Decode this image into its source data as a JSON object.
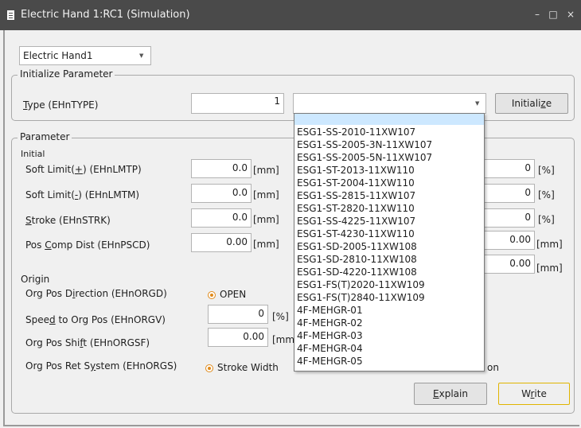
{
  "window": {
    "title": "Electric Hand 1:RC1  (Simulation)",
    "minimize_glyph": "–",
    "maximize_glyph": "□",
    "close_glyph": "×"
  },
  "colors": {
    "titlebar": "#4a4a4a",
    "accent_orange": "#e08a1a",
    "highlight": "#cde8ff"
  },
  "hand_selector": {
    "value": "Electric Hand1"
  },
  "init_group": {
    "legend": "Initialize Parameter",
    "type_label_u": "T",
    "type_label_rest": "ype (EHnTYPE)",
    "type_value": "1",
    "model_value": "",
    "initialize_pre": "Initiali",
    "initialize_u": "z",
    "initialize_post": "e"
  },
  "param_group": {
    "legend": "Parameter",
    "initial_heading": "Initial",
    "soft_limit_plus": {
      "pre": "Soft Limit(",
      "u": "+",
      "post": ") (EHnLMTP)",
      "value": "0.0",
      "unit": "[mm]"
    },
    "soft_limit_minus": {
      "pre": "Soft Limit(",
      "u": "-",
      "post": ") (EHnLMTM)",
      "value": "0.0",
      "unit": "[mm]"
    },
    "stroke": {
      "pre": "",
      "u": "S",
      "post": "troke (EHnSTRK)",
      "value": "0.0",
      "unit": "[mm]"
    },
    "pos_comp": {
      "pre": "Pos ",
      "u": "C",
      "post": "omp Dist (EHnPSCD)",
      "value": "0.00",
      "unit": "[mm]"
    },
    "right_values": [
      {
        "value": "0",
        "unit": "[%]"
      },
      {
        "value": "0",
        "unit": "[%]"
      },
      {
        "value": "0",
        "unit": "[%]"
      },
      {
        "value": "0.00",
        "unit": "[mm]"
      },
      {
        "value": "0.00",
        "unit": "[mm]"
      }
    ],
    "origin_heading": "Origin",
    "org_dir": {
      "pre": "Org Pos D",
      "u": "i",
      "post": "rection (EHnORGD)",
      "option": "OPEN"
    },
    "org_speed": {
      "pre": "Spee",
      "u": "d",
      "post": " to Org Pos (EHnORGV)",
      "value": "0",
      "unit": "[%]"
    },
    "org_shift": {
      "pre": "Org Pos Shi",
      "u": "f",
      "post": "t (EHnORGSF)",
      "value": "0.00",
      "unit": "[mm"
    },
    "org_ret": {
      "pre": "Org Pos Ret S",
      "u": "y",
      "post": "stem (EHnORGS)",
      "option": "Stroke Width",
      "option_tail": "on"
    },
    "explain_u": "E",
    "explain_rest": "xplain",
    "write_pre": "W",
    "write_u": "r",
    "write_post": "ite"
  },
  "dropdown_items": [
    "ESG1-SS-2010-11XW107",
    "ESG1-SS-2005-3N-11XW107",
    "ESG1-SS-2005-5N-11XW107",
    "ESG1-ST-2013-11XW110",
    "ESG1-ST-2004-11XW110",
    "ESG1-SS-2815-11XW107",
    "ESG1-ST-2820-11XW110",
    "ESG1-SS-4225-11XW107",
    "ESG1-ST-4230-11XW110",
    "ESG1-SD-2005-11XW108",
    "ESG1-SD-2810-11XW108",
    "ESG1-SD-4220-11XW108",
    "ESG1-FS(T)2020-11XW109",
    "ESG1-FS(T)2840-11XW109",
    "4F-MEHGR-01",
    "4F-MEHGR-02",
    "4F-MEHGR-03",
    "4F-MEHGR-04",
    "4F-MEHGR-05"
  ]
}
